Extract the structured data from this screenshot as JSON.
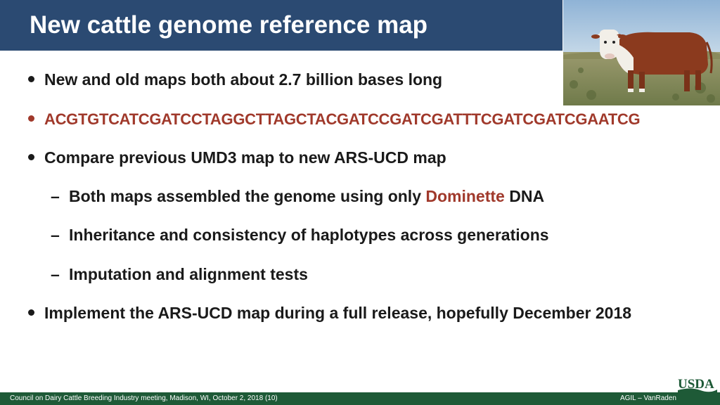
{
  "title": "New cattle genome reference map",
  "photo_icon": "hereford-cow-photo",
  "bullets": [
    {
      "text": "New and old maps both about 2.7 billion bases long"
    },
    {
      "text": "ACGTGTCATCGATCCTAGGCTTAGCTACGATCCGATCGATTTCGATCGATCGAATCG"
    },
    {
      "text": "Compare previous UMD3 map to new ARS-UCD map"
    },
    {
      "text": "Implement the ARS-UCD map during a full release, hopefully December 2018"
    }
  ],
  "sub_bullets": [
    {
      "before": "Both maps assembled the genome using only ",
      "highlight": "Dominette",
      "after": " DNA"
    },
    {
      "text": "Inheritance and consistency of haplotypes across generations"
    },
    {
      "text": "Imputation and alignment tests"
    }
  ],
  "sub_marker": "–",
  "footer": {
    "left": "Council on Dairy Cattle Breeding Industry meeting, Madison, WI, October 2, 2018 (10)",
    "right": "AGIL – VanRaden"
  },
  "logo": {
    "text": "USDA",
    "icon": "usda-logo"
  },
  "colors": {
    "title_bar": "#2b4a72",
    "accent_red": "#a0392b",
    "footer_green": "#1e5a37"
  }
}
